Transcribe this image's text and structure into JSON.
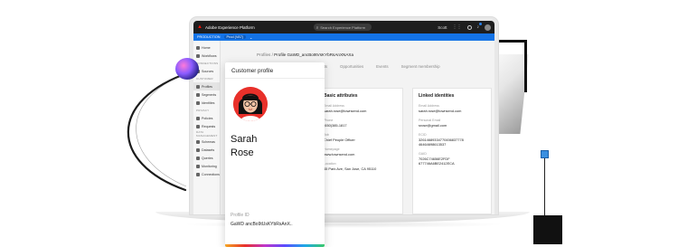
{
  "app": {
    "title": "Adobe Experience Platform",
    "search_placeholder": "Search Experience Platform",
    "user_name": "Scott"
  },
  "sandbox": {
    "env": "PRODUCTION",
    "name": "Prod (VA7)"
  },
  "sidebar": {
    "items": [
      {
        "type": "item",
        "label": "Home",
        "icon": "home-icon"
      },
      {
        "type": "item",
        "label": "Workflows",
        "icon": "workflow-icon"
      },
      {
        "type": "header",
        "label": "CONNECTIONS"
      },
      {
        "type": "item",
        "label": "Sources",
        "icon": "sources-icon"
      },
      {
        "type": "header",
        "label": "CUSTOMER"
      },
      {
        "type": "item",
        "label": "Profiles",
        "icon": "profiles-icon",
        "active": true
      },
      {
        "type": "item",
        "label": "Segments",
        "icon": "segments-icon"
      },
      {
        "type": "item",
        "label": "Identities",
        "icon": "identities-icon"
      },
      {
        "type": "header",
        "label": "PRIVACY"
      },
      {
        "type": "item",
        "label": "Policies",
        "icon": "policies-icon"
      },
      {
        "type": "item",
        "label": "Requests",
        "icon": "requests-icon"
      },
      {
        "type": "header",
        "label": "DATA MANAGEMENT"
      },
      {
        "type": "item",
        "label": "Schemas",
        "icon": "schemas-icon"
      },
      {
        "type": "item",
        "label": "Datasets",
        "icon": "datasets-icon"
      },
      {
        "type": "item",
        "label": "Queries",
        "icon": "queries-icon"
      },
      {
        "type": "item",
        "label": "Monitoring",
        "icon": "monitoring-icon"
      },
      {
        "type": "item",
        "label": "Connections",
        "icon": "connections-icon"
      }
    ]
  },
  "breadcrumb": {
    "parent": "Profiles",
    "current": "Profile GaWD_ancBo9tVsKYbRsAnXNAXa"
  },
  "tabs": [
    "Details",
    "Attributes",
    "Accounts",
    "Opportunities",
    "Events",
    "Segment membership"
  ],
  "basic": {
    "title": "Basic attributes",
    "fields": [
      {
        "label": "Email Address",
        "value": "sarah.rose@townsend.com"
      },
      {
        "label": "Phone",
        "value": "(650)385-1817"
      },
      {
        "label": "Job",
        "value": "Chief People Officer"
      },
      {
        "label": "Homepage",
        "value": "www.townsend.com"
      },
      {
        "label": "Location",
        "value": "45 Park Ave, San Jose, CA 95110"
      }
    ]
  },
  "linked": {
    "title": "Linked identities",
    "fields": [
      {
        "label": "Email Address",
        "value": "sarah.rose@townsend.com"
      },
      {
        "label": "Personal Email",
        "value": "srose@gmail.com"
      },
      {
        "label": "ECID",
        "value": "32614689334770456837778 46464698613537"
      },
      {
        "label": "GAID",
        "value": "7026C74656E2FDF 677746A6BE2412ECA"
      }
    ]
  },
  "profile_card": {
    "title": "Customer profile",
    "first_name": "Sarah",
    "last_name": "Rose",
    "id_label": "Profile ID",
    "id_value": "GaWD ancBo9tUsKYbRsAnX.."
  },
  "colors": {
    "brand_red": "#fa0f00",
    "accent_blue": "#1473e6",
    "avatar_bg": "#e8302a"
  }
}
